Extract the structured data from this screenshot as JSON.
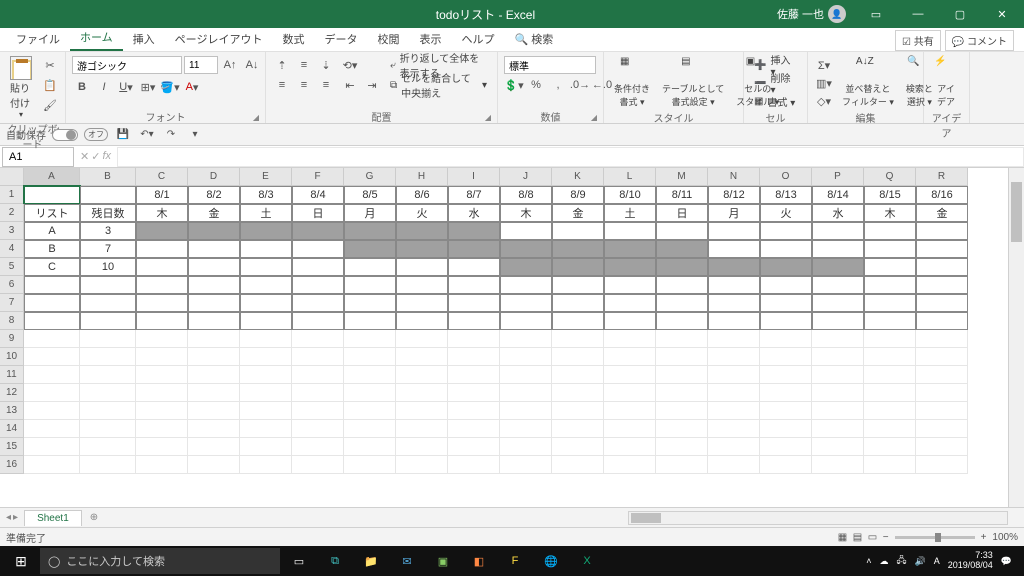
{
  "title": "todoリスト - Excel",
  "user": "佐藤 一也",
  "tabs": {
    "file": "ファイル",
    "home": "ホーム",
    "insert": "挿入",
    "pagelayout": "ページレイアウト",
    "formulas": "数式",
    "data": "データ",
    "review": "校閲",
    "view": "表示",
    "help": "ヘルプ",
    "search": "検索"
  },
  "share": "共有",
  "comment": "コメント",
  "groups": {
    "clipboard": "クリップボード",
    "font": "フォント",
    "alignment": "配置",
    "number": "数値",
    "styles": "スタイル",
    "cells": "セル",
    "editing": "編集",
    "ideas": "アイデア"
  },
  "paste": "貼り付け",
  "font_name": "游ゴシック",
  "font_size": "11",
  "wrap": "折り返して全体を表示する",
  "merge": "セルを結合して中央揃え",
  "numfmt": "標準",
  "style_btns": {
    "cond": "条件付き\n書式 ▾",
    "table": "テーブルとして\n書式設定 ▾",
    "cell": "セルの\nスタイル ▾"
  },
  "cell_btns": {
    "insert": "挿入 ▾",
    "delete": "削除 ▾",
    "format": "書式 ▾"
  },
  "sort": "並べ替えと\nフィルター ▾",
  "find": "検索と\n選択 ▾",
  "ideas": "アイ\nデア",
  "autosave_label": "自動保存",
  "autosave_state": "オフ",
  "namebox": "A1",
  "cols": [
    "A",
    "B",
    "C",
    "D",
    "E",
    "F",
    "G",
    "H",
    "I",
    "J",
    "K",
    "L",
    "M",
    "N",
    "O",
    "P",
    "Q",
    "R"
  ],
  "dates": [
    "8/1",
    "8/2",
    "8/3",
    "8/4",
    "8/5",
    "8/6",
    "8/7",
    "8/8",
    "8/9",
    "8/10",
    "8/11",
    "8/12",
    "8/13",
    "8/14",
    "8/15",
    "8/16"
  ],
  "hdr_list": "リスト",
  "hdr_days": "残日数",
  "dow": [
    "木",
    "金",
    "土",
    "日",
    "月",
    "火",
    "水",
    "木",
    "金",
    "土",
    "日",
    "月",
    "火",
    "水",
    "木",
    "金"
  ],
  "rows_data": [
    {
      "name": "A",
      "days": "3",
      "shade": [
        0,
        1,
        2,
        3,
        4,
        5,
        6
      ]
    },
    {
      "name": "B",
      "days": "7",
      "shade": [
        4,
        5,
        6,
        7,
        8,
        9,
        10
      ]
    },
    {
      "name": "C",
      "days": "10",
      "shade": [
        7,
        8,
        9,
        10,
        11,
        12,
        13
      ]
    }
  ],
  "sheet": "Sheet1",
  "status": "準備完了",
  "zoom": "100%",
  "taskbar_search": "ここに入力して検索",
  "clock_time": "7:33",
  "clock_date": "2019/08/04"
}
